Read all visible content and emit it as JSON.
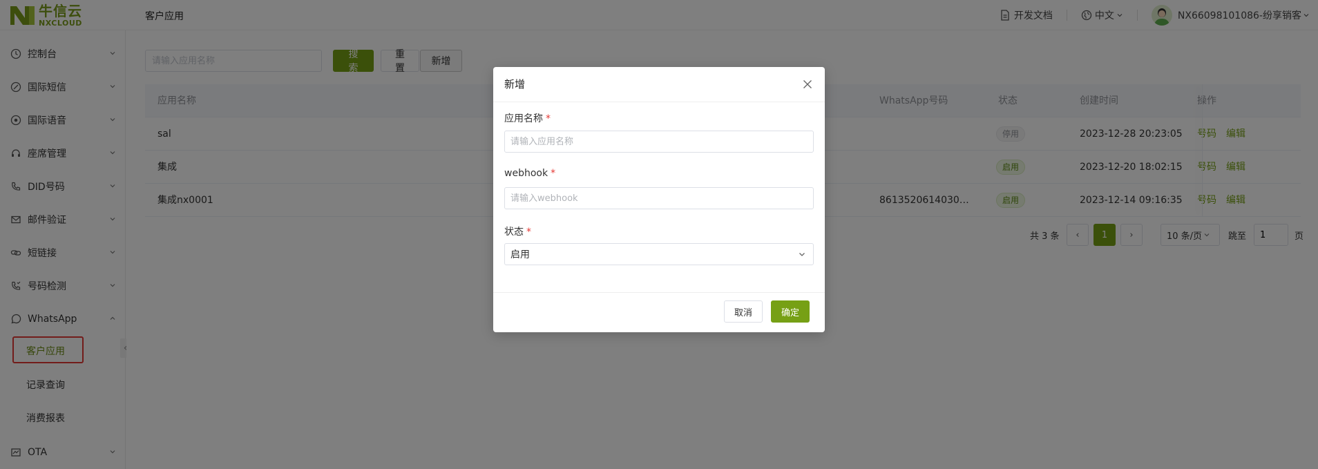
{
  "brand": {
    "name_cn": "牛信云",
    "name_en": "NXCLOUD",
    "color": "#76a015"
  },
  "header": {
    "page_title": "客户应用",
    "docs_label": "开发文档",
    "language": "中文",
    "user": "NX66098101086-纷享销客"
  },
  "sidebar": {
    "items": [
      {
        "label": "控制台",
        "icon": "dashboard-icon"
      },
      {
        "label": "国际短信",
        "icon": "sms-icon"
      },
      {
        "label": "国际语音",
        "icon": "voice-icon"
      },
      {
        "label": "座席管理",
        "icon": "headset-icon"
      },
      {
        "label": "DID号码",
        "icon": "phone-icon"
      },
      {
        "label": "邮件验证",
        "icon": "mail-icon"
      },
      {
        "label": "短链接",
        "icon": "link-icon"
      },
      {
        "label": "号码检测",
        "icon": "phone-check-icon"
      },
      {
        "label": "WhatsApp",
        "icon": "whatsapp-icon"
      },
      {
        "label": "OTA",
        "icon": "ota-icon"
      }
    ],
    "whatsapp_sub": [
      "客户应用",
      "记录查询",
      "消费报表"
    ],
    "collapse_glyph": "«"
  },
  "toolbar": {
    "search_placeholder": "请输入应用名称",
    "search_label": "搜索",
    "reset_label": "重置",
    "add_label": "新增"
  },
  "table": {
    "headers": {
      "name": "应用名称",
      "whatsapp": "WhatsApp号码",
      "status": "状态",
      "created": "创建时间",
      "ops": "操作"
    },
    "rows": [
      {
        "name": "sal",
        "whatsapp": "",
        "status": "停用",
        "created": "2023-12-28 20:23:05"
      },
      {
        "name": "集成",
        "whatsapp": "",
        "status": "启用",
        "created": "2023-12-20 18:02:15"
      },
      {
        "name": "集成nx0001",
        "whatsapp": "8613520614030,8...",
        "status": "启用",
        "created": "2023-12-14 09:16:35"
      }
    ],
    "op_number": "号码",
    "op_edit": "编辑"
  },
  "pagination": {
    "total_text": "共 3 条",
    "current_page": "1",
    "page_size": "10 条/页",
    "jump_label": "跳至",
    "jump_value": "1",
    "page_suffix": "页",
    "prev_glyph": "‹",
    "next_glyph": "›"
  },
  "modal": {
    "title": "新增",
    "fields": {
      "name_label": "应用名称",
      "name_placeholder": "请输入应用名称",
      "webhook_label": "webhook",
      "webhook_placeholder": "请输入webhook",
      "status_label": "状态",
      "status_value": "启用"
    },
    "required_mark": "*",
    "cancel_label": "取消",
    "confirm_label": "确定"
  }
}
